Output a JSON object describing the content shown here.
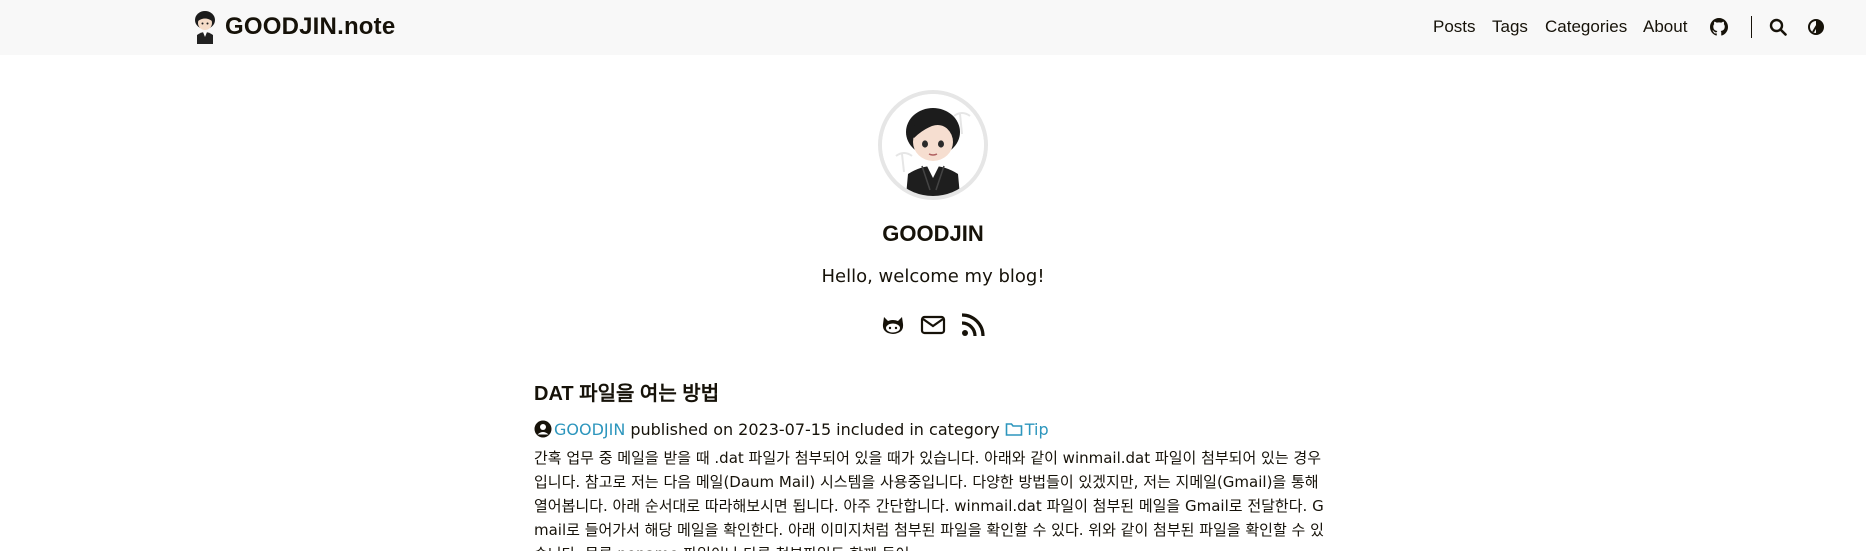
{
  "header": {
    "logo_text": "GOODJIN.note",
    "nav": [
      {
        "label": "Posts"
      },
      {
        "label": "Tags"
      },
      {
        "label": "Categories"
      },
      {
        "label": "About"
      }
    ],
    "icons": [
      "github-icon",
      "search-icon",
      "theme-toggle-icon"
    ]
  },
  "profile": {
    "name": "GOODJIN",
    "subtitle": "Hello, welcome my blog!",
    "social_icons": [
      "github-icon",
      "email-icon",
      "rss-icon"
    ]
  },
  "post": {
    "title": "DAT 파일을 여는 방법",
    "author": "GOODJIN",
    "published_prefix": "published on",
    "date": "2023-07-15",
    "category_prefix": "included in category",
    "category": "Tip",
    "summary": "간혹 업무 중 메일을 받을 때 .dat 파일가 첨부되어 있을 때가 있습니다. 아래와 같이 winmail.dat 파일이 첨부되어 있는 경우입니다. 참고로 저는 다음 메일(Daum Mail) 시스템을 사용중입니다. 다양한 방법들이 있겠지만, 저는 지메일(Gmail)을 통해 열어봅니다. 아래 순서대로 따라해보시면 됩니다. 아주 간단합니다. winmail.dat 파일이 첨부된 메일을 Gmail로 전달한다. Gmail로 들어가서 해당 메일을 확인한다. 아래 이미지처럼 첨부된 파일을 확인할 수 있다. 위와 같이 첨부된 파일을 확인할 수 있습니다. 물론 noname 파일이나 다른 첨부파일도 함께 들어"
  },
  "colors": {
    "header_bg": "#f8f8f8",
    "text": "#161209",
    "link": "#2d96bd",
    "avatar_border": "#e6e6e6"
  }
}
